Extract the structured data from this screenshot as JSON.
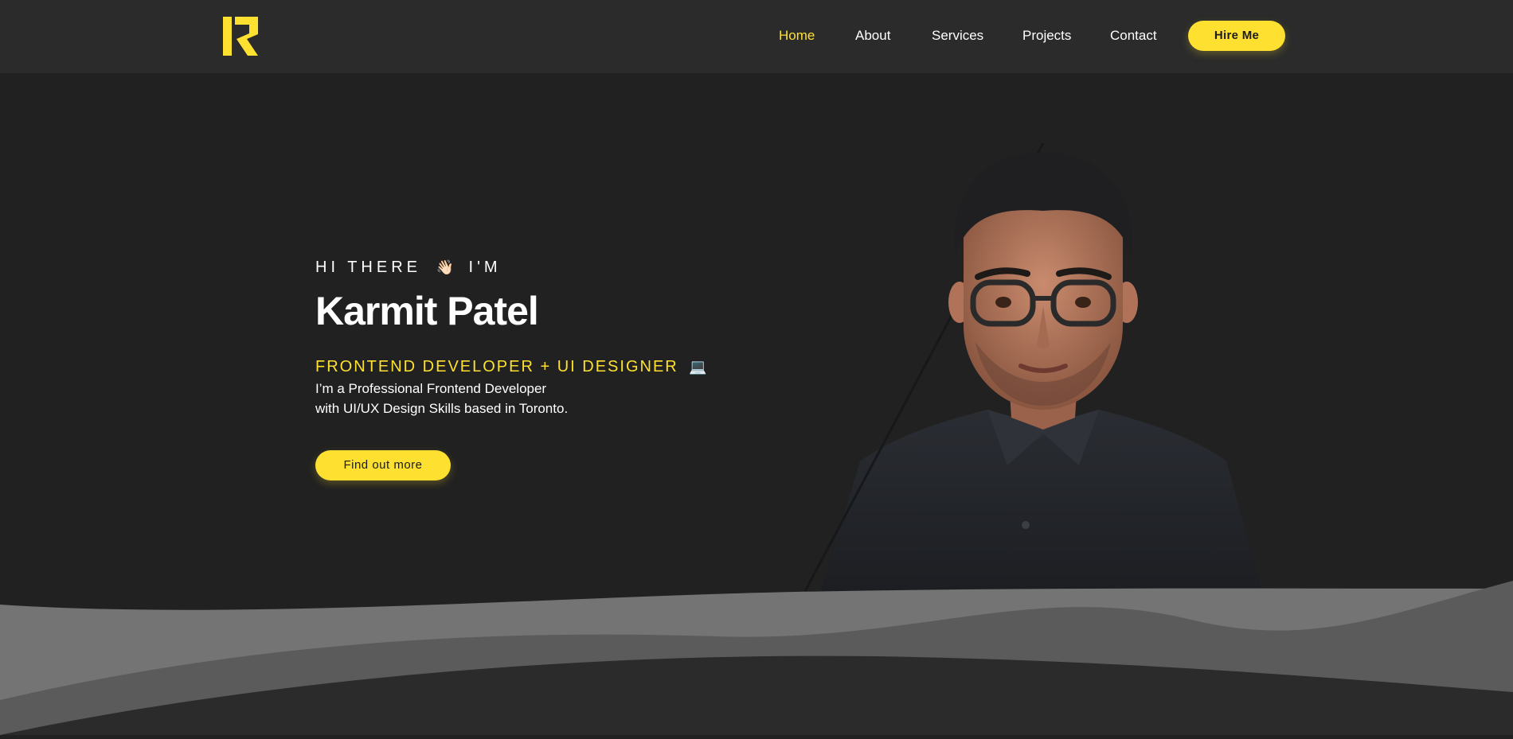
{
  "brand": {
    "logo_letter": "R",
    "accent_color": "#fde030"
  },
  "nav": {
    "items": [
      {
        "label": "Home",
        "active": true
      },
      {
        "label": "About",
        "active": false
      },
      {
        "label": "Services",
        "active": false
      },
      {
        "label": "Projects",
        "active": false
      },
      {
        "label": "Contact",
        "active": false
      }
    ],
    "hire_label": "Hire Me"
  },
  "hero": {
    "greeting": "HI THERE",
    "greeting_emoji": "👋🏻",
    "greeting_suffix": "I'M",
    "name": "Karmit Patel",
    "role": "FRONTEND DEVELOPER + UI DESIGNER",
    "role_emoji": "💻",
    "description_line1": "I’m a Professional Frontend Developer",
    "description_line2": "with UI/UX Design Skills based in Toronto.",
    "cta_label": "Find out more"
  },
  "avatar": {
    "icon": "avatar-3d-portrait"
  }
}
